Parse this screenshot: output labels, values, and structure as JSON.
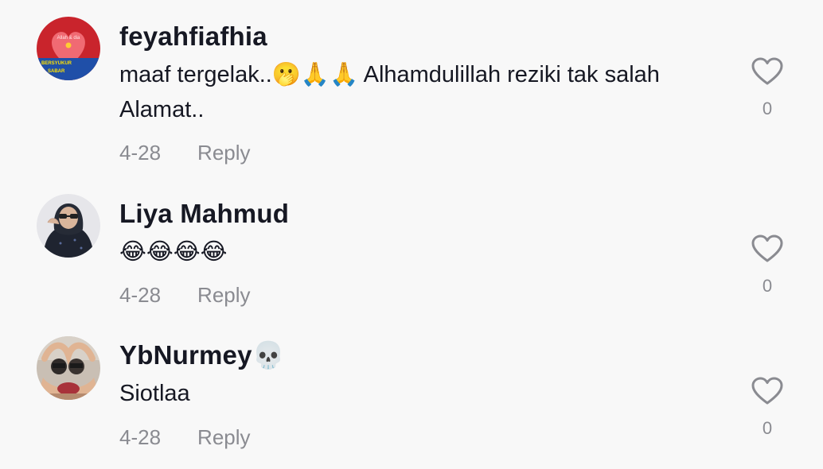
{
  "comments": [
    {
      "username": "feyahfiafhia",
      "text": "maaf tergelak..🫢🙏🙏 Alhamdulillah reziki tak salah Alamat..",
      "date": "4-28",
      "reply_label": "Reply",
      "likes": "0",
      "avatar_text": [
        "Allah & dia",
        "BERSYUKUR",
        "SABAR"
      ]
    },
    {
      "username": "Liya Mahmud",
      "text": "😂😂😂😂",
      "date": "4-28",
      "reply_label": "Reply",
      "likes": "0"
    },
    {
      "username": "YbNurmey💀",
      "text": "Siotlaa",
      "date": "4-28",
      "reply_label": "Reply",
      "likes": "0"
    }
  ],
  "colors": {
    "background": "#f8f8f8",
    "username": "#161823",
    "meta": "#8a8b91",
    "heart_outline": "#8a8b91"
  },
  "icons": {
    "like": "heart-outline-icon"
  }
}
